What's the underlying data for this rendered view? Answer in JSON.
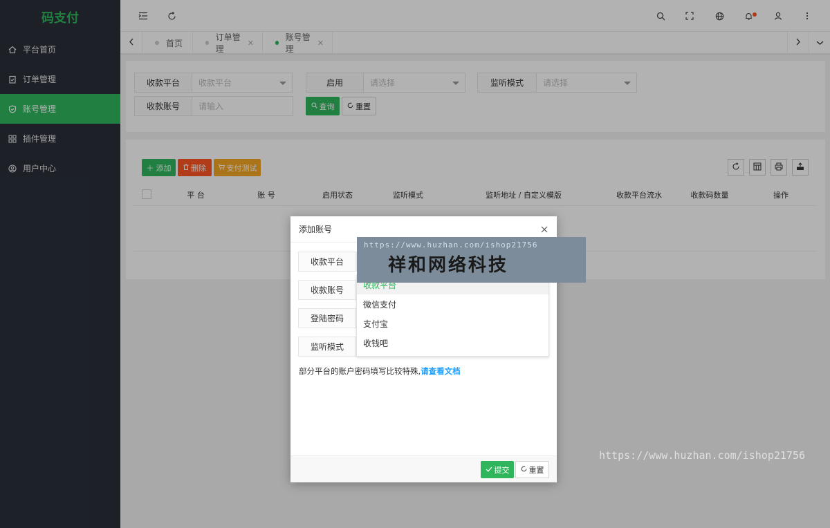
{
  "sidebar": {
    "logo": "码支付",
    "items": [
      {
        "label": "平台首页",
        "icon": "home-icon"
      },
      {
        "label": "订单管理",
        "icon": "clipboard-icon"
      },
      {
        "label": "账号管理",
        "icon": "shield-icon"
      },
      {
        "label": "插件管理",
        "icon": "grid-icon"
      },
      {
        "label": "用户中心",
        "icon": "user-circle-icon"
      }
    ],
    "active_index": 2,
    "colors": {
      "bg": "#2a3039",
      "active": "#2fb65d"
    }
  },
  "header": {
    "icons": [
      "menu-fold-icon",
      "refresh-icon",
      "search-icon",
      "fullscreen-icon",
      "globe-icon",
      "bell-icon",
      "user-icon",
      "more-icon"
    ]
  },
  "tabs": [
    {
      "label": "首页",
      "closable": false,
      "active": false
    },
    {
      "label": "订单管理",
      "closable": true,
      "active": false
    },
    {
      "label": "账号管理",
      "closable": true,
      "active": true
    }
  ],
  "search": {
    "platform_label": "收款平台",
    "platform_placeholder": "收款平台",
    "enabled_label": "启用",
    "enabled_placeholder": "请选择",
    "listen_label": "监听模式",
    "listen_placeholder": "请选择",
    "account_label": "收款账号",
    "account_placeholder": "请输入",
    "query_button": "查询",
    "reset_button": "重置"
  },
  "toolbar": {
    "add_button": "添加",
    "delete_button": "删除",
    "paytest_button": "支付测试"
  },
  "table": {
    "columns": [
      "平 台",
      "账 号",
      "启用状态",
      "监听模式",
      "监听地址 / 自定义模版",
      "收款平台流水",
      "收款码数量",
      "操作"
    ]
  },
  "modal": {
    "title": "添加账号",
    "fields": [
      "收款平台",
      "收款账号",
      "登陆密码",
      "监听模式"
    ],
    "dropdown_options": [
      "收款平台",
      "微信支付",
      "支付宝",
      "收钱吧"
    ],
    "dropdown_selected": 0,
    "note": "部分平台的账户密码填写比较特殊,",
    "note_link": "请查看文档",
    "submit_button": "提交",
    "reset_button": "重置"
  },
  "watermark": {
    "url": "https://www.huzhan.com/ishop21756",
    "name": "祥和网络科技",
    "url2": "https://www.huzhan.com/ishop21756"
  }
}
